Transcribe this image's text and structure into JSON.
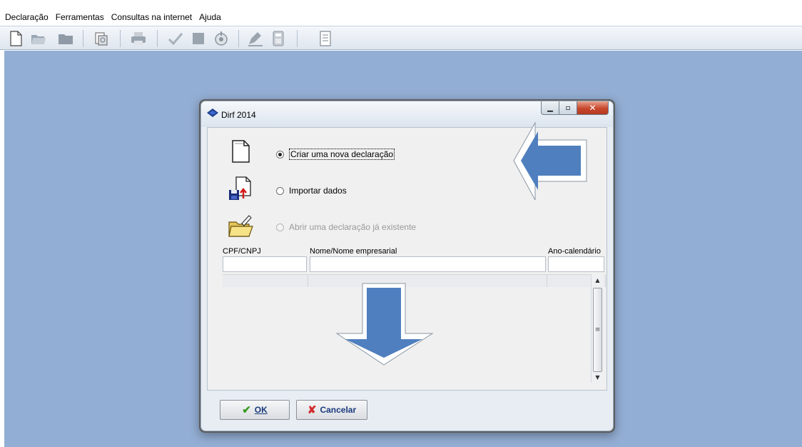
{
  "menu": {
    "items": [
      "Declaração",
      "Ferramentas",
      "Consultas na internet",
      "Ajuda"
    ]
  },
  "toolbar": {
    "icons": [
      "new-file-icon",
      "open-folder-icon",
      "folder-icon",
      "recover-icon",
      "print-icon",
      "check-icon",
      "stop-icon",
      "transmit-icon",
      "edit-icon",
      "calculator-icon",
      "report-icon"
    ]
  },
  "dialog": {
    "title": "Dirf 2014",
    "options": {
      "create": "Criar uma nova declaração",
      "import": "Importar dados",
      "open": "Abrir uma declaração já existente"
    },
    "columns": {
      "cpf": "CPF/CNPJ",
      "name": "Nome/Nome empresarial",
      "year": "Ano-calendário"
    },
    "buttons": {
      "ok": "OK",
      "cancel": "Cancelar"
    }
  },
  "colors": {
    "workspace": "#93aed4",
    "annotation_arrow": "#4f7fbe"
  }
}
